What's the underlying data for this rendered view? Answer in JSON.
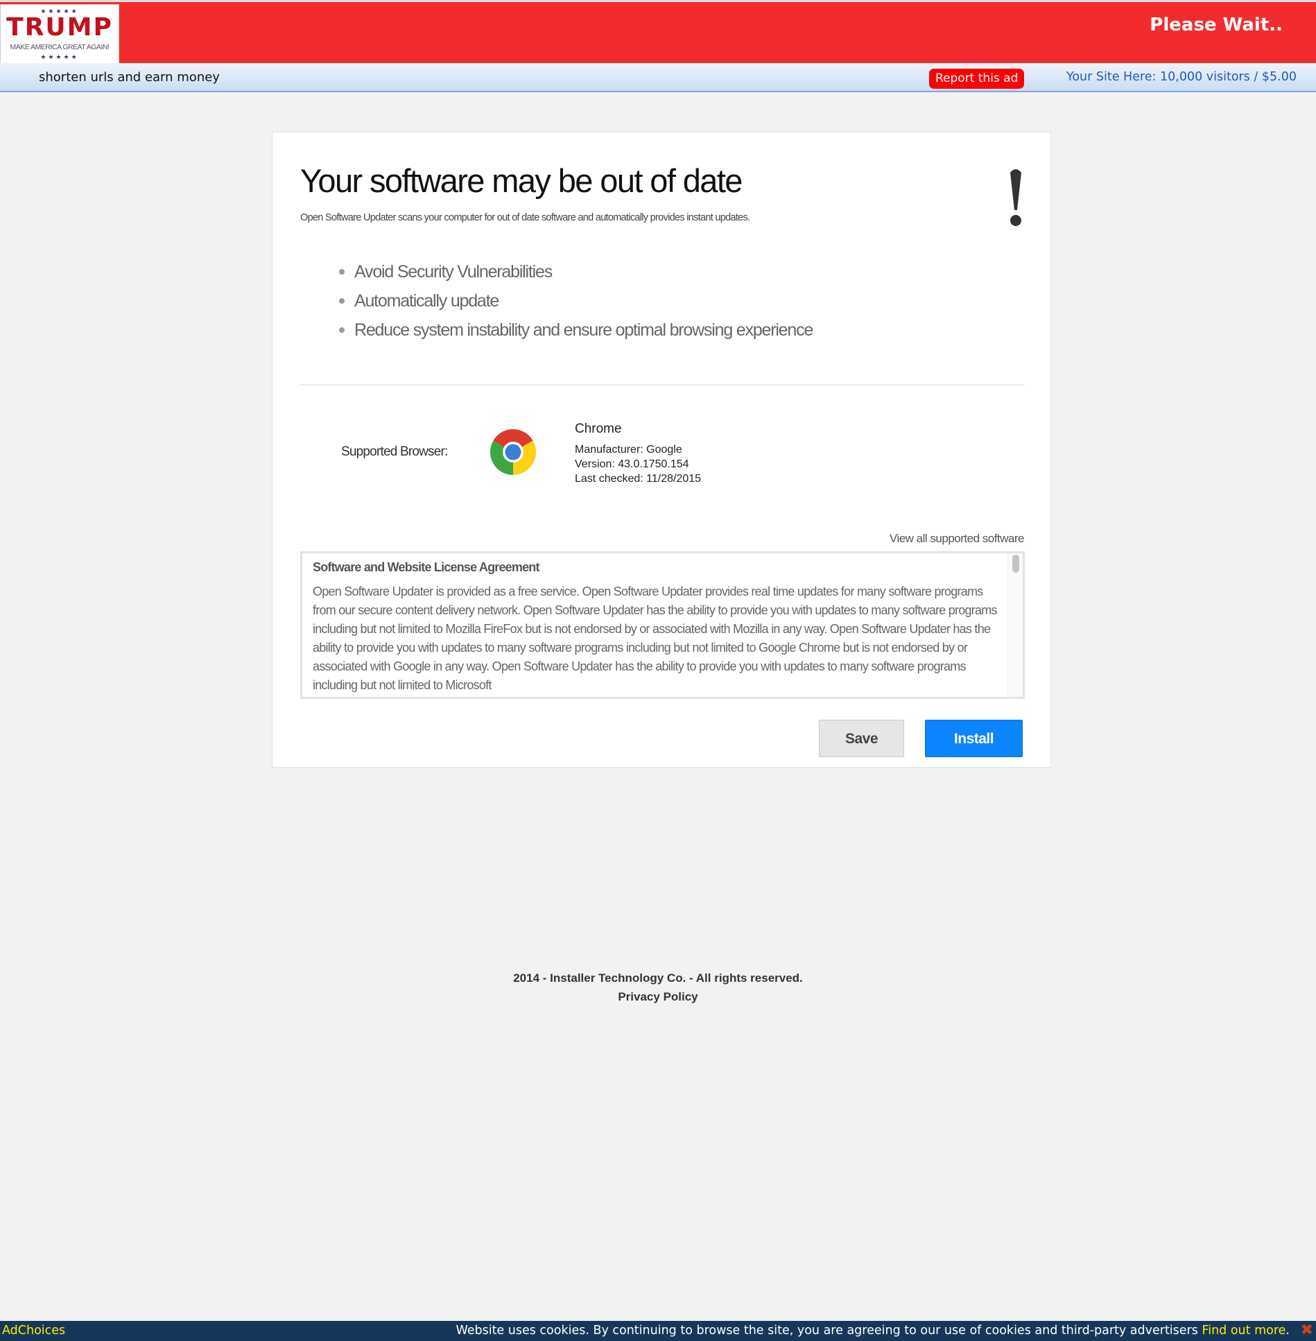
{
  "header": {
    "logo": {
      "stars": "★★★★★",
      "word": "TRUMP",
      "tagline": "MAKE AMERICA GREAT AGAIN!"
    },
    "status": "Please Wait.."
  },
  "subbar": {
    "tagline": "shorten urls and earn money",
    "report_label": "Report this ad",
    "advertise": "Your Site Here: 10,000 visitors / $5.00"
  },
  "card": {
    "title": "Your software may be out of date",
    "subtitle": "Open Software Updater scans your computer for out of date software and automatically provides instant updates.",
    "bullets": [
      "Avoid Security Vulnerabilities",
      "Automatically update",
      "Reduce system instability and ensure optimal browsing experience"
    ],
    "supported_label": "Supported Browser:",
    "browser": {
      "name": "Chrome",
      "manufacturer": "Manufacturer: Google",
      "version": "Version: 43.0.1750.154",
      "last_checked": "Last checked: 11/28/2015"
    },
    "view_all": "View all supported software",
    "license": {
      "heading": "Software and Website License Agreement",
      "text": "Open Software Updater is provided as a free service. Open Software Updater provides real time updates for many software programs from our secure content delivery network. Open Software Updater has the ability to provide you with updates to many software programs including but not limited to Mozilla FireFox but is not endorsed by or associated with Mozilla in any way. Open Software Updater has the ability to provide you with updates to many software programs including but not limited to Google Chrome but is not endorsed by or associated with Google in any way. Open Software Updater has the ability to provide you with updates to many software programs including but not limited to Microsoft"
    },
    "save_label": "Save",
    "install_label": "Install"
  },
  "footer": {
    "copyright": "2014 - Installer Technology Co. - All rights reserved.",
    "privacy": "Privacy Policy"
  },
  "cookiebar": {
    "adchoices": "AdChoices",
    "text": "Website uses cookies. By continuing to browse the site, you are agreeing to our use of cookies and third-party advertisers ",
    "find_out": "Find out more",
    "period": ".",
    "close": "✖"
  },
  "colors": {
    "header_red": "#f22c2e",
    "install_blue": "#0b84ff",
    "cookiebar": "#17375a",
    "link_yellow": "#ffeb00"
  }
}
